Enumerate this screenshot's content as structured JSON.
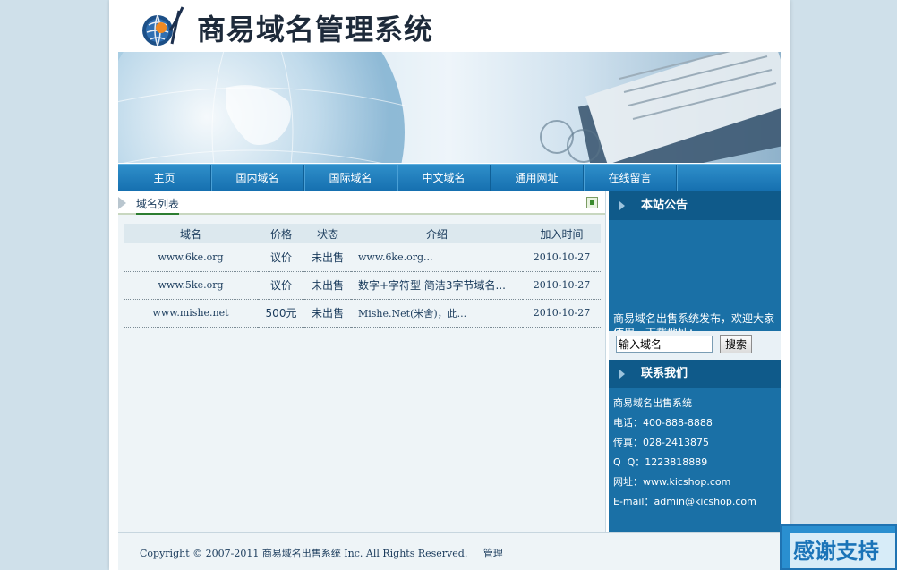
{
  "header": {
    "title": "商易域名管理系统"
  },
  "nav": {
    "items": [
      {
        "label": "主页"
      },
      {
        "label": "国内域名"
      },
      {
        "label": "国际域名"
      },
      {
        "label": "中文域名"
      },
      {
        "label": "通用网址"
      },
      {
        "label": "在线留言"
      }
    ]
  },
  "main": {
    "tab_title": "域名列表",
    "columns": {
      "domain": "域名",
      "price": "价格",
      "status": "状态",
      "intro": "介绍",
      "date": "加入时间"
    },
    "rows": [
      {
        "domain": "www.6ke.org",
        "price": "议价",
        "status": "未出售",
        "intro": "www.6ke.org...",
        "date": "2010-10-27"
      },
      {
        "domain": "www.5ke.org",
        "price": "议价",
        "status": "未出售",
        "intro": "数字+字符型 简洁3字节域名...",
        "date": "2010-10-27"
      },
      {
        "domain": "www.mishe.net",
        "price": "500元",
        "status": "未出售",
        "intro": "Mishe.Net(米舍)，此...",
        "date": "2010-10-27"
      }
    ]
  },
  "sidebar": {
    "notice_title": "本站公告",
    "notice_text": "商易域名出售系统发布，欢迎大家使用，下载地址：http://www.kicshop.com",
    "search": {
      "placeholder": "输入域名",
      "value": "输入域名",
      "button": "搜索"
    },
    "contact_title": "联系我们",
    "contact_lines": [
      "商易域名出售系统",
      "电话：400-888-8888",
      "传真：028-2413875",
      "Q  Q：1223818889",
      "网址：www.kicshop.com",
      "E-mail：admin@kicshop.com"
    ]
  },
  "footer": {
    "copyright": "Copyright © 2007-2011 商易域名出售系统 Inc. All Rights Reserved.",
    "admin_link": "管理"
  },
  "thanks_badge": {
    "label": "感谢支持"
  },
  "colors": {
    "nav_blue": "#1a7bbd",
    "sidebar_blue": "#1a70a6",
    "sidebar_header": "#0f5a8a",
    "main_bg": "#eef4f7",
    "page_bg": "#cfe0ea"
  }
}
